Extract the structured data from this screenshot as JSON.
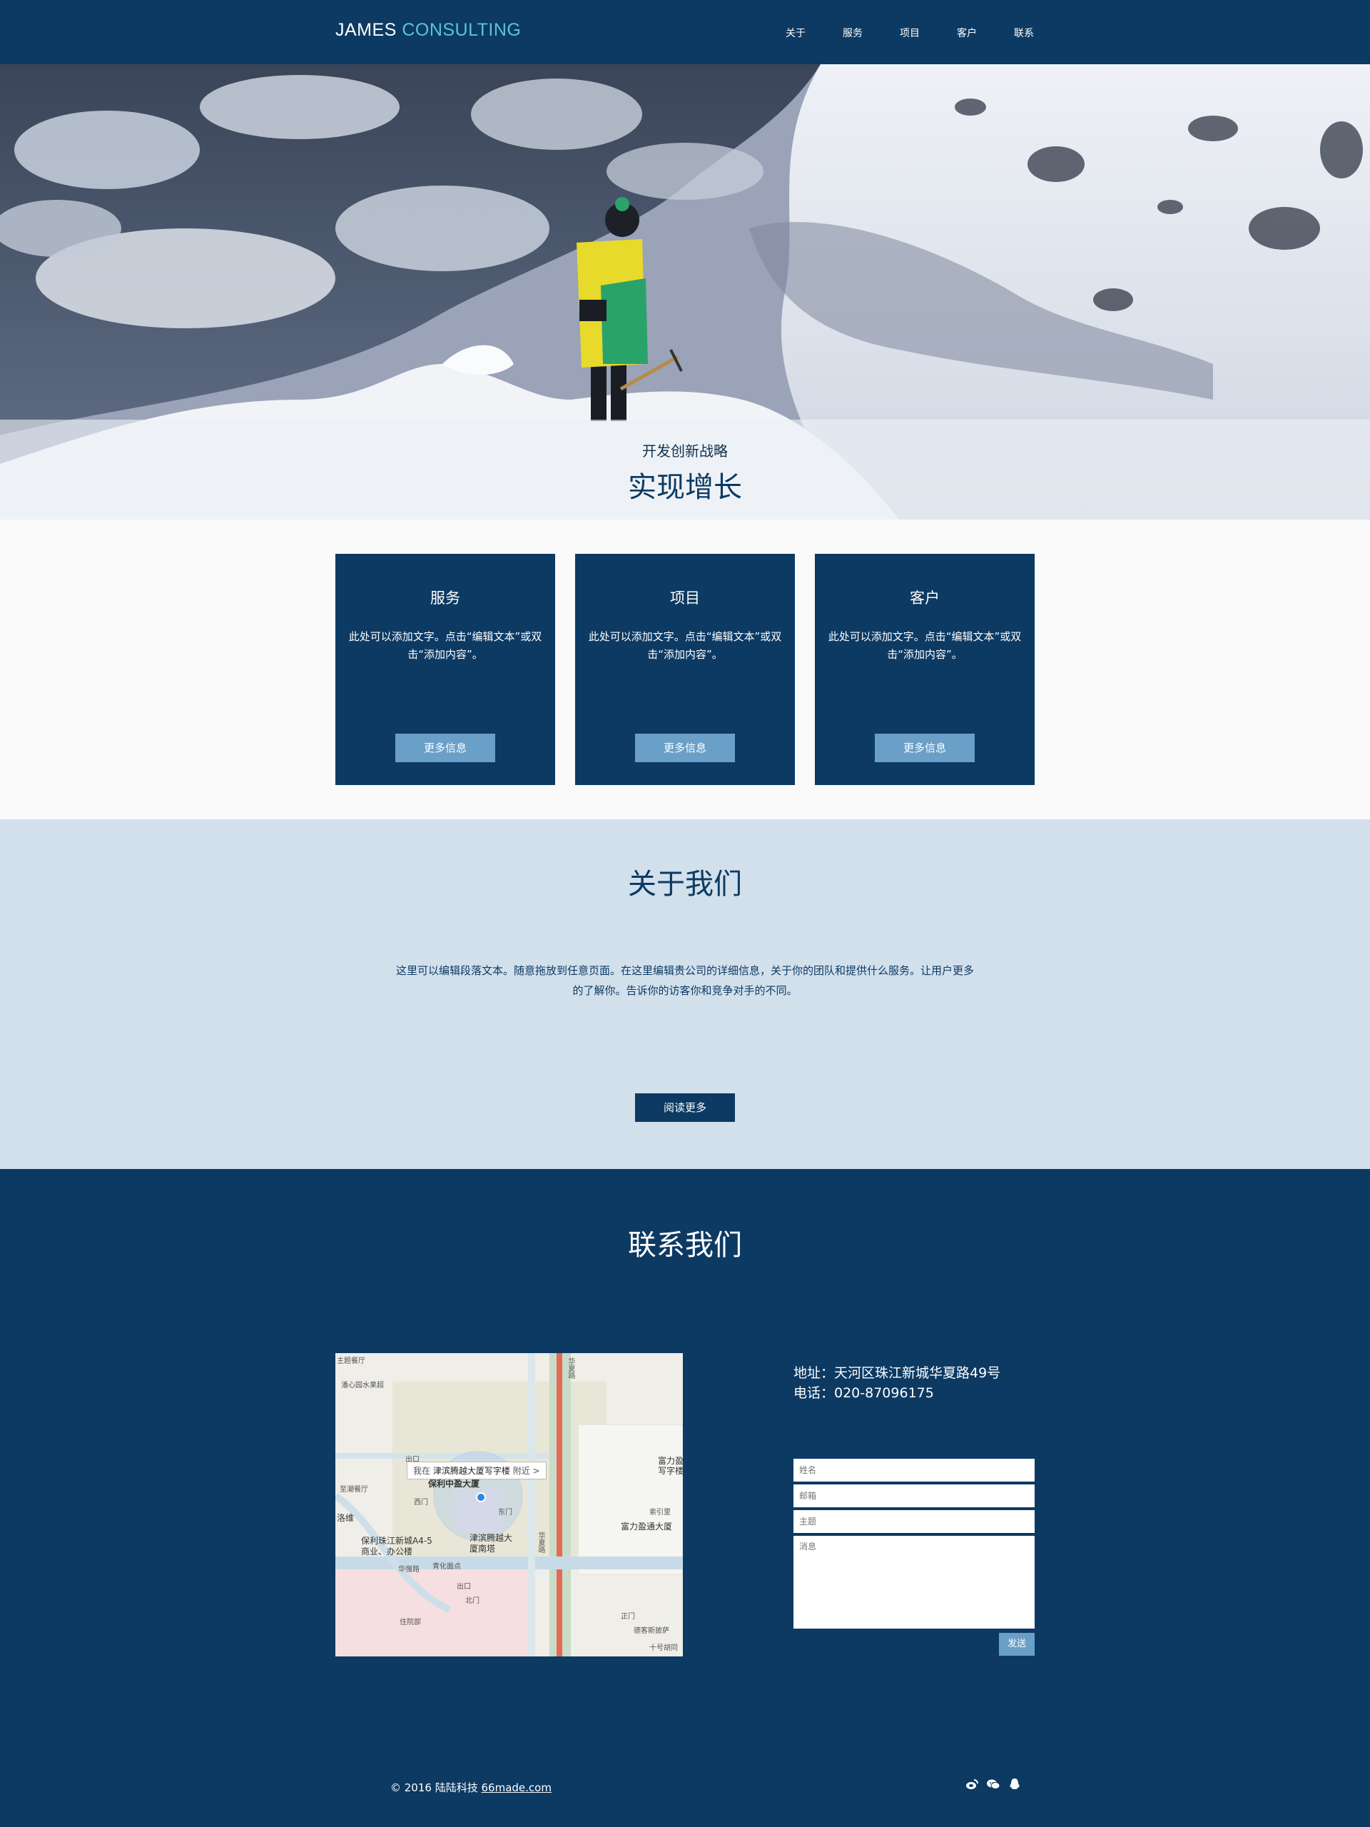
{
  "header": {
    "logo_main": "JAMES",
    "logo_accent": "CONSULTING",
    "nav": [
      "关于",
      "服务",
      "项目",
      "客户",
      "联系"
    ]
  },
  "hero": {
    "subtitle": "开发创新战略",
    "title": "实现增长"
  },
  "cards": [
    {
      "title": "服务",
      "text": "此处可以添加文字。点击“编辑文本”或双击“添加内容”。",
      "button": "更多信息"
    },
    {
      "title": "项目",
      "text": "此处可以添加文字。点击“编辑文本”或双击“添加内容”。",
      "button": "更多信息"
    },
    {
      "title": "客户",
      "text": "此处可以添加文字。点击“编辑文本”或双击“添加内容”。",
      "button": "更多信息"
    }
  ],
  "about": {
    "title": "关于我们",
    "text": "这里可以编辑段落文本。随意拖放到任意页面。在这里编辑贵公司的详细信息，关于你的团队和提供什么服务。让用户更多的了解你。告诉你的访客你和竞争对手的不同。",
    "button": "阅读更多"
  },
  "contact": {
    "title": "联系我们",
    "address": "地址：天河区珠江新城华夏路49号",
    "phone": "电话：020-87096175",
    "form": {
      "name_placeholder": "姓名",
      "email_placeholder": "邮箱",
      "subject_placeholder": "主题",
      "message_placeholder": "消息",
      "send": "发送"
    },
    "map": {
      "tip_prefix": "我在",
      "tip_place": "津滨腾越大厦写字楼",
      "tip_suffix": "附近 >",
      "labels": {
        "restaurant_top": "主题餐厅",
        "deli": "潘心园水果超",
        "exit": "出口",
        "west_gate": "西门",
        "restaurant_left": "至潮餐厅",
        "luowei": "洛维",
        "poly": "保利珠江新城A4-5商业、办公楼",
        "jinbin": "津滨腾越大厦南塔",
        "qinghua": "青化面点",
        "huaqiang": "华强路",
        "exit2": "出口",
        "north_gate": "北门",
        "club": "住院部",
        "fuli_top": "富力盈写字楼",
        "suoyin": "索引里",
        "fuli": "富力盈通大厦",
        "east_gate": "东门",
        "front_gate": "正门",
        "pizza": "德客斯披萨",
        "hutong": "十号胡同",
        "huaxia": "华夏路",
        "huaxia2": "华夏路",
        "mid_mark": "保利中盈大厦"
      }
    }
  },
  "footer": {
    "copyright": "© 2016 陆陆科技",
    "link": "66made.com",
    "social": [
      "weibo-icon",
      "wechat-icon",
      "qq-icon"
    ]
  },
  "colors": {
    "primary": "#0c3a63",
    "accent": "#5bc2de",
    "button": "#6a9fc8",
    "about_bg": "#d2e0ec"
  }
}
